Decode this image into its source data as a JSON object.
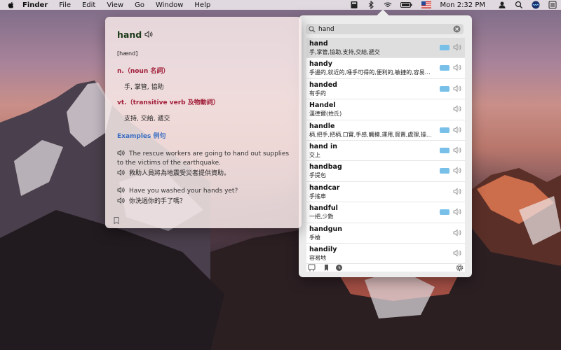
{
  "menubar": {
    "app_name": "Finder",
    "menus": [
      "File",
      "Edit",
      "View",
      "Go",
      "Window",
      "Help"
    ],
    "clock": "Mon 2:32 PM",
    "status_icons": [
      "dictionary-icon",
      "bluetooth-icon",
      "wifi-icon",
      "battery-icon",
      "flag-icon",
      "user-icon",
      "search-icon",
      "siri-icon",
      "list-icon"
    ]
  },
  "search": {
    "query": "hand"
  },
  "results": [
    {
      "word": "hand",
      "def": "手,掌管,協助,支持,交給,遞交",
      "badge": true
    },
    {
      "word": "handy",
      "def": "手邊的,就近的,唾手可得的,便利的,敏捷的,容易取得的",
      "badge": true
    },
    {
      "word": "handed",
      "def": "有手的",
      "badge": true
    },
    {
      "word": "Handel",
      "def": "漢德爾(姓氏)",
      "badge": false
    },
    {
      "word": "handle",
      "def": "柄,把手,把柄,口實,手感,觸摸,運用,買賣,處理,操作,…",
      "badge": true
    },
    {
      "word": "hand in",
      "def": "交上",
      "badge": true
    },
    {
      "word": "handbag",
      "def": "手提包",
      "badge": true
    },
    {
      "word": "handcar",
      "def": "手搖車",
      "badge": false
    },
    {
      "word": "handful",
      "def": "一把,少數",
      "badge": true
    },
    {
      "word": "handgun",
      "def": "手槍",
      "badge": false
    },
    {
      "word": "handily",
      "def": "容易地",
      "badge": false
    }
  ],
  "entry": {
    "headword": "hand",
    "ipa": "[hænd]",
    "pos1": "n.（noun 名詞）",
    "sense1": "手, 掌管, 協助",
    "pos2": "vt.（transitive verb 及物動詞）",
    "sense2": "支持, 交給, 遞交",
    "examples_heading": "Examples 例句",
    "examples": [
      {
        "en": "The rescue workers are going to hand out supplies to the victims of the earthquake.",
        "zh": "救助人員將為地震受災者提供資助。"
      },
      {
        "en": "Have you washed your hands yet?",
        "zh": "你洗過你的手了嗎？"
      }
    ]
  },
  "colors": {
    "pos": "#a21f3b",
    "examples": "#3b6ec2",
    "badge": "#79c0e8"
  }
}
